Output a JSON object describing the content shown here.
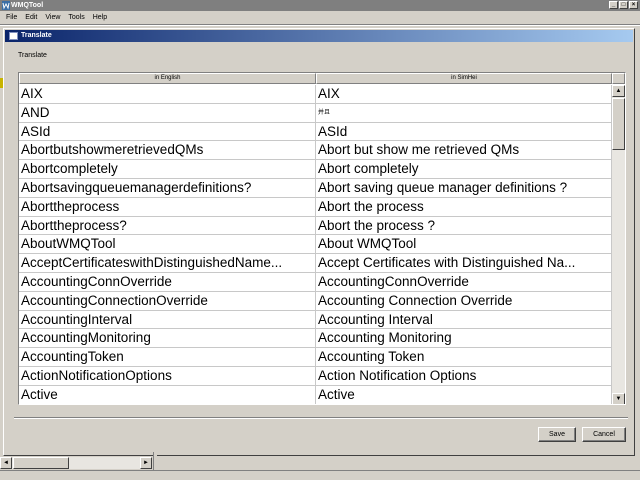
{
  "app": {
    "title": "WMQTool",
    "controls": [
      "_",
      "□",
      "×"
    ]
  },
  "menubar": [
    "File",
    "Edit",
    "View",
    "Tools",
    "Help"
  ],
  "dialog": {
    "title": "Translate",
    "heading": "Translate",
    "columns": [
      "in English",
      "in SimHei"
    ],
    "rows": [
      {
        "en": "AIX",
        "cn": "AIX"
      },
      {
        "en": "AND",
        "cn": "并且"
      },
      {
        "en": "ASId",
        "cn": "ASId"
      },
      {
        "en": "AbortbutshowmeretrievedQMs",
        "cn": "Abort but show me retrieved QMs"
      },
      {
        "en": "Abortcompletely",
        "cn": "Abort completely"
      },
      {
        "en": "Abortsavingqueuemanagerdefinitions?",
        "cn": "Abort saving queue manager definitions ?"
      },
      {
        "en": "Aborttheprocess",
        "cn": "Abort the process"
      },
      {
        "en": "Aborttheprocess?",
        "cn": "Abort the process ?"
      },
      {
        "en": "AboutWMQTool",
        "cn": "About WMQTool"
      },
      {
        "en": "AcceptCertificateswithDistinguishedName...",
        "cn": "Accept Certificates with Distinguished Na..."
      },
      {
        "en": "AccountingConnOverride",
        "cn": "AccountingConnOverride"
      },
      {
        "en": "AccountingConnectionOverride",
        "cn": "Accounting Connection Override"
      },
      {
        "en": "AccountingInterval",
        "cn": "Accounting Interval"
      },
      {
        "en": "AccountingMonitoring",
        "cn": "Accounting Monitoring"
      },
      {
        "en": "AccountingToken",
        "cn": "Accounting Token"
      },
      {
        "en": "ActionNotificationOptions",
        "cn": "Action Notification Options"
      },
      {
        "en": "Active",
        "cn": "Active"
      }
    ],
    "buttons": {
      "save": "Save",
      "cancel": "Cancel"
    }
  },
  "scroll": {
    "up": "▲",
    "down": "▼",
    "left": "◄",
    "right": "►"
  },
  "colors": {
    "title_active_start": "#0a246a",
    "title_active_end": "#a6caf0",
    "face": "#d4d0c8"
  }
}
